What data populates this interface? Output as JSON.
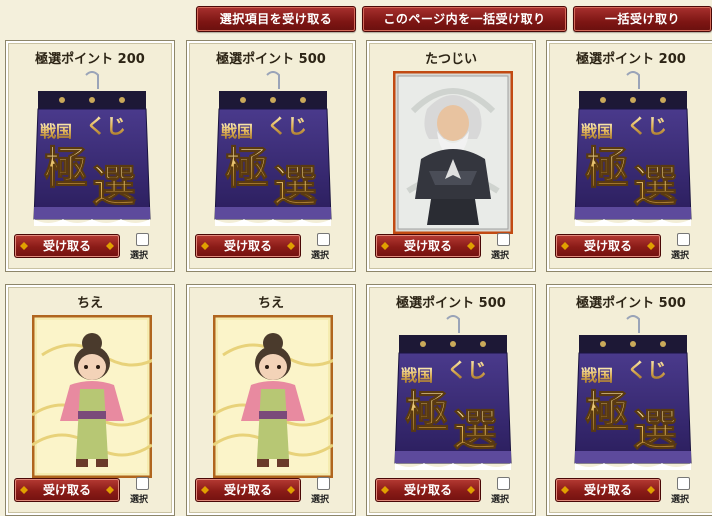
{
  "toolbar": {
    "receive_selected": "選択項目を受け取る",
    "receive_page": "このページ内を一括受け取り",
    "receive_all": "一括受け取り"
  },
  "cards": [
    {
      "title": "極選ポイント 200",
      "type": "ticket",
      "button": "受け取る",
      "check_label": "選択",
      "checked": false
    },
    {
      "title": "極選ポイント 500",
      "type": "ticket",
      "button": "受け取る",
      "check_label": "選択",
      "checked": false
    },
    {
      "title": "たつじい",
      "type": "character-elder",
      "button": "受け取る",
      "check_label": "選択",
      "checked": false
    },
    {
      "title": "極選ポイント 200",
      "type": "ticket",
      "button": "受け取る",
      "check_label": "選択",
      "checked": false
    },
    {
      "title": "ちえ",
      "type": "character-girl",
      "button": "受け取る",
      "check_label": "選択",
      "checked": false
    },
    {
      "title": "ちえ",
      "type": "character-girl",
      "button": "受け取る",
      "check_label": "選択",
      "checked": false
    },
    {
      "title": "極選ポイント 500",
      "type": "ticket",
      "button": "受け取る",
      "check_label": "選択",
      "checked": false
    },
    {
      "title": "極選ポイント 500",
      "type": "ticket",
      "button": "受け取る",
      "check_label": "選択",
      "checked": false
    }
  ],
  "ticket_art": {
    "line1": "戦国",
    "line2": "くじ",
    "line3": "極",
    "line4": "選"
  },
  "colors": {
    "button_red": "#8a1b17",
    "ticket_purple": "#3b2a7a",
    "gold": "#e0b860",
    "card_bg": "#f3eed7"
  }
}
